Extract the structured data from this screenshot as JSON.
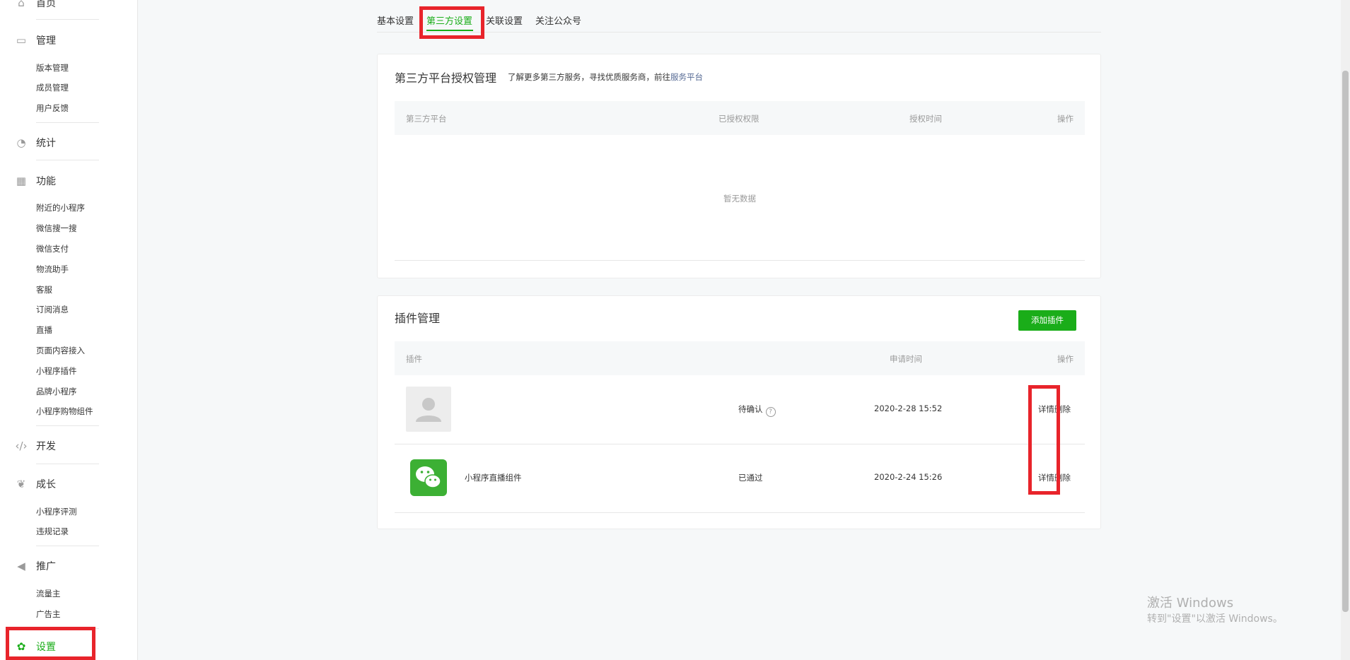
{
  "sidebar": {
    "home": "首页",
    "manage": {
      "label": "管理",
      "items": [
        "版本管理",
        "成员管理",
        "用户反馈"
      ]
    },
    "stats": {
      "label": "统计"
    },
    "features": {
      "label": "功能",
      "items": [
        "附近的小程序",
        "微信搜一搜",
        "微信支付",
        "物流助手",
        "客服",
        "订阅消息",
        "直播",
        "页面内容接入",
        "小程序插件",
        "品牌小程序",
        "小程序购物组件"
      ]
    },
    "dev": {
      "label": "开发"
    },
    "growth": {
      "label": "成长",
      "items": [
        "小程序评测",
        "违规记录"
      ]
    },
    "promo": {
      "label": "推广",
      "items": [
        "流量主",
        "广告主"
      ]
    },
    "settings": {
      "label": "设置"
    }
  },
  "tabs": [
    "基本设置",
    "第三方设置",
    "关联设置",
    "关注公众号"
  ],
  "third_party": {
    "title": "第三方平台授权管理",
    "subtitle_prefix": "了解更多第三方服务，寻找优质服务商，前往",
    "subtitle_link": "服务平台",
    "columns": [
      "第三方平台",
      "已授权权限",
      "授权时间",
      "操作"
    ],
    "empty": "暂无数据"
  },
  "plugins": {
    "title": "插件管理",
    "add_button": "添加插件",
    "columns": [
      "插件",
      "申请时间",
      "操作"
    ],
    "rows": [
      {
        "name": "",
        "status": "待确认",
        "time": "2020-2-28 15:52",
        "detail": "详情",
        "delete": "删除"
      },
      {
        "name": "小程序直播组件",
        "status": "已通过",
        "time": "2020-2-24 15:26",
        "detail": "详情",
        "delete": "删除"
      }
    ]
  },
  "watermark": {
    "line1": "激活 Windows",
    "line2": "转到\"设置\"以激活 Windows。"
  },
  "colors": {
    "accent": "#1aad19",
    "link": "#576b95",
    "highlight": "#e8242b"
  }
}
